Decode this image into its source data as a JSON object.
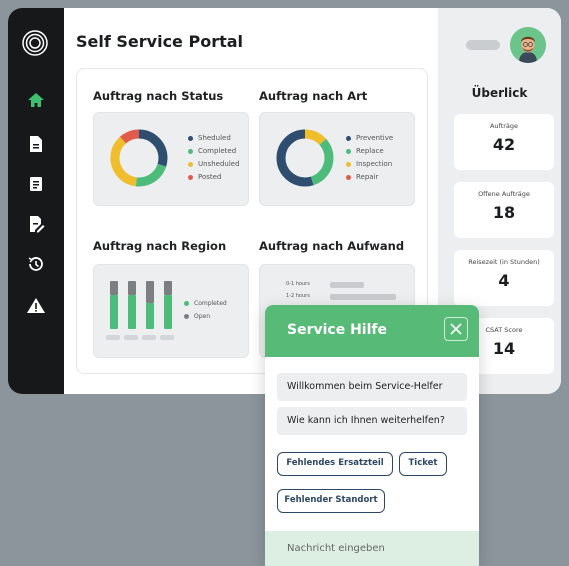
{
  "main": {
    "title": "Self Service Portal",
    "cards": [
      {
        "title": "Auftrag nach Status",
        "legend": [
          "Sheduled",
          "Completed",
          "Unsheduled",
          "Posted"
        ]
      },
      {
        "title": "Auftrag nach Art",
        "legend": [
          "Preventive",
          "Replace",
          "Inspection",
          "Repair"
        ]
      },
      {
        "title": "Auftrag nach Region",
        "legend": [
          "Completed",
          "Open"
        ]
      },
      {
        "title": "Auftrag nach Aufwand",
        "rows": [
          "0-1 hours",
          "1-2 hours"
        ]
      }
    ]
  },
  "colors": {
    "dark_blue": "#2f4e6f",
    "green": "#4dbb7a",
    "yellow": "#f0bd2c",
    "red": "#e15b4b",
    "gray": "#7b7f82",
    "accent_green": "#57bb77"
  },
  "sidebar": {
    "icons": [
      "logo-icon",
      "home-icon",
      "document-icon",
      "list-document-icon",
      "edit-document-icon",
      "history-icon",
      "warning-icon"
    ]
  },
  "overview": {
    "title": "Überlick",
    "stats": [
      {
        "label": "Aufträge",
        "value": "42"
      },
      {
        "label": "Offene Aufträge",
        "value": "18"
      },
      {
        "label": "Reisezeit (in Stunden)",
        "value": "4"
      },
      {
        "label": "CSAT Score",
        "value": "14"
      }
    ]
  },
  "chat": {
    "title": "Service Hilfe",
    "messages": [
      "Willkommen beim Service-Helfer",
      "Wie kann ich Ihnen weiterhelfen?"
    ],
    "options": [
      "Fehlendes Ersatzteil",
      "Ticket",
      "Fehlender Standort"
    ],
    "input_placeholder": "Nachricht eingeben"
  }
}
